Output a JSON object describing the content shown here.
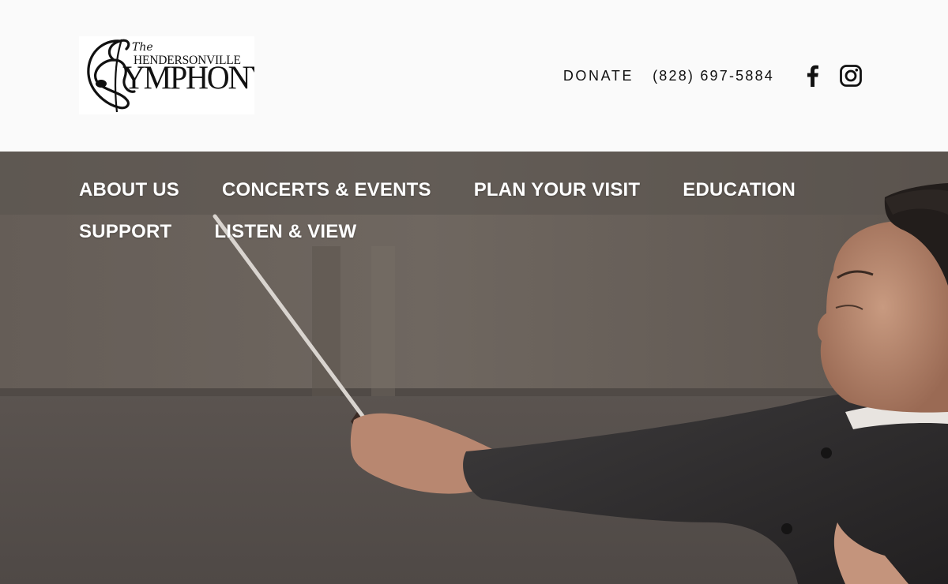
{
  "logo": {
    "the": "The",
    "hendersonville": "HENDERSONVILLE",
    "symphony": "YMPHONY"
  },
  "utility": {
    "donate": "DONATE",
    "phone": "(828) 697-5884",
    "social": [
      {
        "icon": "facebook-icon"
      },
      {
        "icon": "instagram-icon"
      }
    ]
  },
  "nav": {
    "items": [
      {
        "label": "ABOUT US"
      },
      {
        "label": "CONCERTS & EVENTS"
      },
      {
        "label": "PLAN YOUR VISIT"
      },
      {
        "label": "EDUCATION"
      },
      {
        "label": "SUPPORT"
      },
      {
        "label": "LISTEN & VIEW"
      }
    ]
  },
  "colors": {
    "header_bg": "#fafafa",
    "hero_bg": "#6e665f",
    "nav_text": "#ffffff",
    "text_dark": "#111111"
  }
}
